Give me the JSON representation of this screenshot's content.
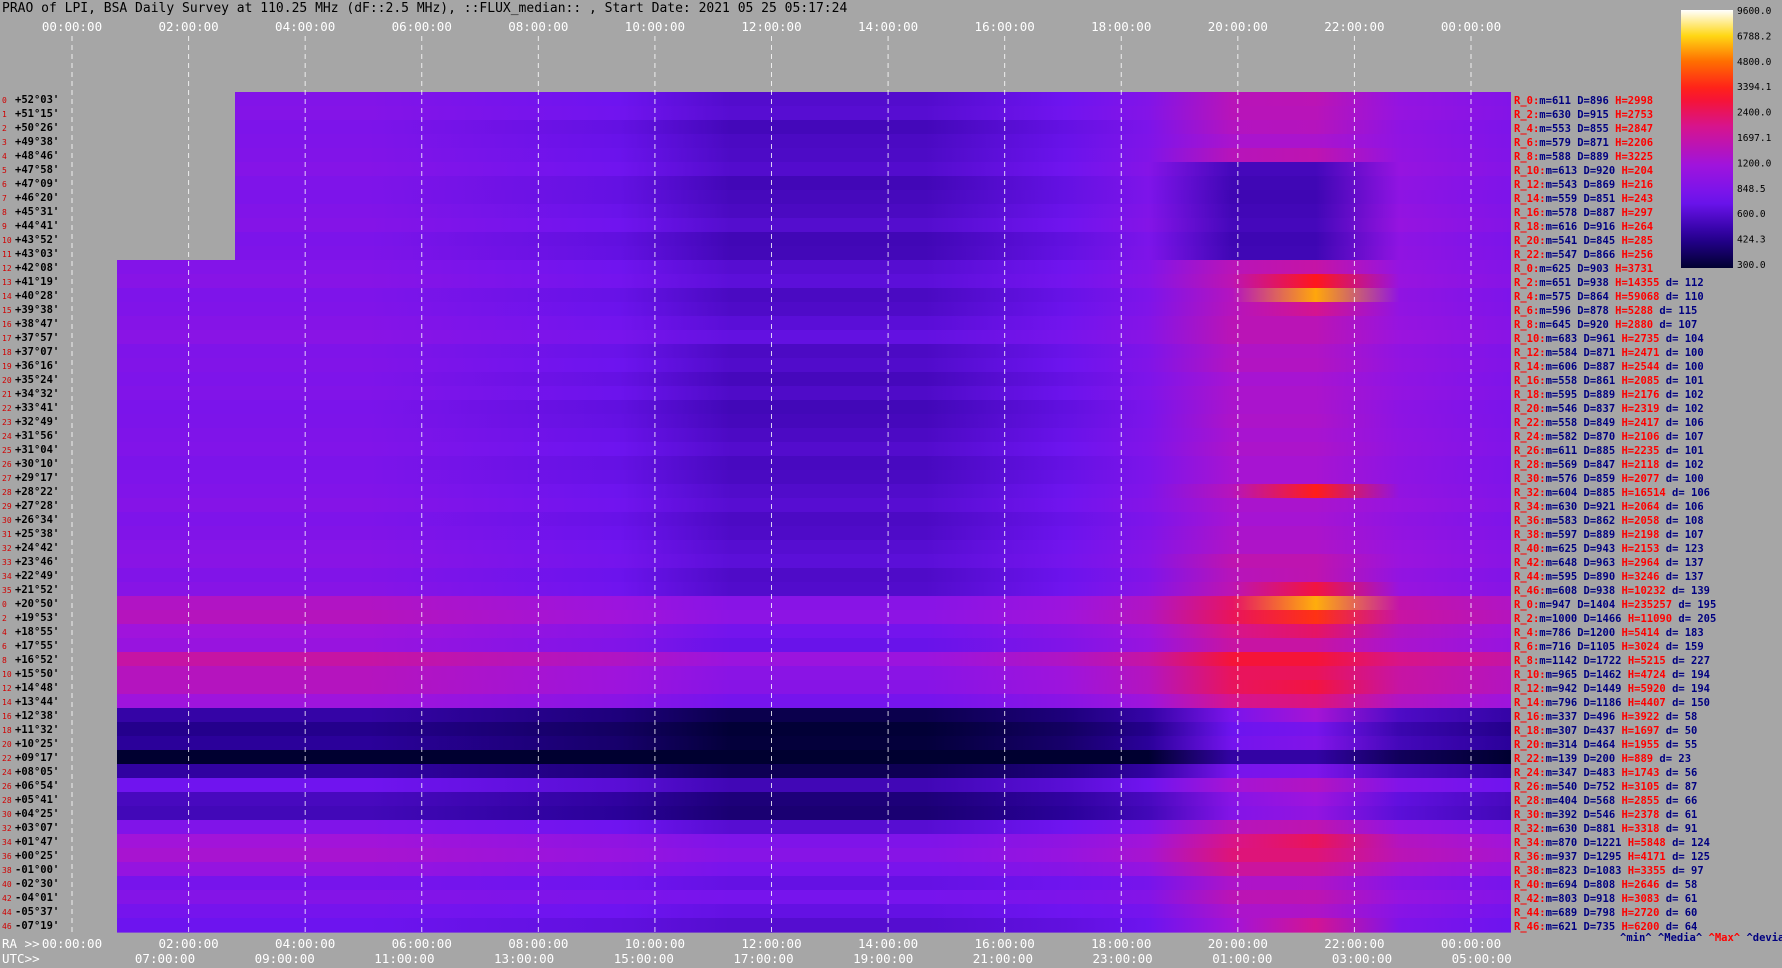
{
  "title": "PRAO of LPI, BSA Daily Survey at 110.25 MHz (dF::2.5 MHz), ::FLUX_median:: , Start Date: 2021 05 25 05:17:24",
  "colors": {
    "background": "#a6a6a6",
    "grid": "#ffffff",
    "min": "#000080",
    "median": "#000080",
    "max": "#ff0000",
    "devia": "#000080",
    "rowlabel": "#d00000"
  },
  "top_axis": [
    "00:00:00",
    "02:00:00",
    "04:00:00",
    "06:00:00",
    "08:00:00",
    "10:00:00",
    "12:00:00",
    "14:00:00",
    "16:00:00",
    "18:00:00",
    "20:00:00",
    "22:00:00",
    "00:00:00"
  ],
  "bottom_axis": {
    "ra_label": "RA >>",
    "ra_ticks": [
      "00:00:00",
      "02:00:00",
      "04:00:00",
      "06:00:00",
      "08:00:00",
      "10:00:00",
      "12:00:00",
      "14:00:00",
      "16:00:00",
      "18:00:00",
      "20:00:00",
      "22:00:00",
      "00:00:00"
    ],
    "utc_label": "UTC>>",
    "utc_ticks": [
      "07:00:00",
      "09:00:00",
      "11:00:00",
      "13:00:00",
      "15:00:00",
      "17:00:00",
      "19:00:00",
      "21:00:00",
      "23:00:00",
      "01:00:00",
      "03:00:00",
      "05:00:00"
    ]
  },
  "colorbar": {
    "ticks": [
      "9600.0",
      "6788.2",
      "4800.0",
      "3394.1",
      "2400.0",
      "1697.1",
      "1200.0",
      "848.5",
      "600.0",
      "424.3",
      "300.0"
    ]
  },
  "stats_legend": {
    "min": "^min^",
    "median": "^Media^",
    "max": "^Max^",
    "devia": "^devia^"
  },
  "chart_data": {
    "type": "heatmap",
    "title": "PRAO of LPI, BSA Daily Survey at 110.25 MHz (dF::2.5 MHz), ::FLUX_median:: , Start Date: 2021 05 25 05:17:24",
    "x_axis_top": "RA 00:00:00 to 00:00:00",
    "color_scale": "log",
    "color_range": [
      300.0,
      9600.0
    ],
    "rows": [
      {
        "num": "0",
        "dec": "+52°03'",
        "label": "R_0:",
        "min": 611,
        "median": 896,
        "max": 2998,
        "devia": null
      },
      {
        "num": "1",
        "dec": "+51°15'",
        "label": "R_2:",
        "min": 630,
        "median": 915,
        "max": 2753,
        "devia": null
      },
      {
        "num": "2",
        "dec": "+50°26'",
        "label": "R_4:",
        "min": 553,
        "median": 855,
        "max": 2847,
        "devia": null
      },
      {
        "num": "3",
        "dec": "+49°38'",
        "label": "R_6:",
        "min": 579,
        "median": 871,
        "max": 2206,
        "devia": null
      },
      {
        "num": "4",
        "dec": "+48°46'",
        "label": "R_8:",
        "min": 588,
        "median": 889,
        "max": 3225,
        "devia": null
      },
      {
        "num": "5",
        "dec": "+47°58'",
        "label": "R_10:",
        "min": 613,
        "median": 920,
        "max": 204,
        "devia": null
      },
      {
        "num": "6",
        "dec": "+47°09'",
        "label": "R_12:",
        "min": 543,
        "median": 869,
        "max": 216,
        "devia": null
      },
      {
        "num": "7",
        "dec": "+46°20'",
        "label": "R_14:",
        "min": 559,
        "median": 851,
        "max": 243,
        "devia": null
      },
      {
        "num": "8",
        "dec": "+45°31'",
        "label": "R_16:",
        "min": 578,
        "median": 887,
        "max": 297,
        "devia": null
      },
      {
        "num": "9",
        "dec": "+44°41'",
        "label": "R_18:",
        "min": 616,
        "median": 916,
        "max": 264,
        "devia": null
      },
      {
        "num": "10",
        "dec": "+43°52'",
        "label": "R_20:",
        "min": 541,
        "median": 845,
        "max": 285,
        "devia": null
      },
      {
        "num": "11",
        "dec": "+43°03'",
        "label": "R_22:",
        "min": 547,
        "median": 866,
        "max": 256,
        "devia": null
      },
      {
        "num": "12",
        "dec": "+42°08'",
        "label": "R_0:",
        "min": 625,
        "median": 903,
        "max": 3731,
        "devia": null
      },
      {
        "num": "13",
        "dec": "+41°19'",
        "label": "R_2:",
        "min": 651,
        "median": 938,
        "max": 14355,
        "devia": 112
      },
      {
        "num": "14",
        "dec": "+40°28'",
        "label": "R_4:",
        "min": 575,
        "median": 864,
        "max": 59068,
        "devia": 110
      },
      {
        "num": "15",
        "dec": "+39°38'",
        "label": "R_6:",
        "min": 596,
        "median": 878,
        "max": 5288,
        "devia": 115
      },
      {
        "num": "16",
        "dec": "+38°47'",
        "label": "R_8:",
        "min": 645,
        "median": 920,
        "max": 2880,
        "devia": 107
      },
      {
        "num": "17",
        "dec": "+37°57'",
        "label": "R_10:",
        "min": 683,
        "median": 961,
        "max": 2735,
        "devia": 104
      },
      {
        "num": "18",
        "dec": "+37°07'",
        "label": "R_12:",
        "min": 584,
        "median": 871,
        "max": 2471,
        "devia": 100
      },
      {
        "num": "19",
        "dec": "+36°16'",
        "label": "R_14:",
        "min": 606,
        "median": 887,
        "max": 2544,
        "devia": 100
      },
      {
        "num": "20",
        "dec": "+35°24'",
        "label": "R_16:",
        "min": 558,
        "median": 861,
        "max": 2085,
        "devia": 101
      },
      {
        "num": "21",
        "dec": "+34°32'",
        "label": "R_18:",
        "min": 595,
        "median": 889,
        "max": 2176,
        "devia": 102
      },
      {
        "num": "22",
        "dec": "+33°41'",
        "label": "R_20:",
        "min": 546,
        "median": 837,
        "max": 2319,
        "devia": 102
      },
      {
        "num": "23",
        "dec": "+32°49'",
        "label": "R_22:",
        "min": 558,
        "median": 849,
        "max": 2417,
        "devia": 106
      },
      {
        "num": "24",
        "dec": "+31°56'",
        "label": "R_24:",
        "min": 582,
        "median": 870,
        "max": 2106,
        "devia": 107
      },
      {
        "num": "25",
        "dec": "+31°04'",
        "label": "R_26:",
        "min": 611,
        "median": 885,
        "max": 2235,
        "devia": 101
      },
      {
        "num": "26",
        "dec": "+30°10'",
        "label": "R_28:",
        "min": 569,
        "median": 847,
        "max": 2118,
        "devia": 102
      },
      {
        "num": "27",
        "dec": "+29°17'",
        "label": "R_30:",
        "min": 576,
        "median": 859,
        "max": 2077,
        "devia": 100
      },
      {
        "num": "28",
        "dec": "+28°22'",
        "label": "R_32:",
        "min": 604,
        "median": 885,
        "max": 16514,
        "devia": 106
      },
      {
        "num": "29",
        "dec": "+27°28'",
        "label": "R_34:",
        "min": 630,
        "median": 921,
        "max": 2064,
        "devia": 106
      },
      {
        "num": "30",
        "dec": "+26°34'",
        "label": "R_36:",
        "min": 583,
        "median": 862,
        "max": 2058,
        "devia": 108
      },
      {
        "num": "31",
        "dec": "+25°38'",
        "label": "R_38:",
        "min": 597,
        "median": 889,
        "max": 2198,
        "devia": 107
      },
      {
        "num": "32",
        "dec": "+24°42'",
        "label": "R_40:",
        "min": 625,
        "median": 943,
        "max": 2153,
        "devia": 123
      },
      {
        "num": "33",
        "dec": "+23°46'",
        "label": "R_42:",
        "min": 648,
        "median": 963,
        "max": 2964,
        "devia": 137
      },
      {
        "num": "34",
        "dec": "+22°49'",
        "label": "R_44:",
        "min": 595,
        "median": 890,
        "max": 3246,
        "devia": 137
      },
      {
        "num": "35",
        "dec": "+21°52'",
        "label": "R_46:",
        "min": 608,
        "median": 938,
        "max": 10232,
        "devia": 139
      },
      {
        "num": "0",
        "dec": "+20°50'",
        "label": "R_0:",
        "min": 947,
        "median": 1404,
        "max": 235257,
        "devia": 195
      },
      {
        "num": "2",
        "dec": "+19°53'",
        "label": "R_2:",
        "min": 1000,
        "median": 1466,
        "max": 11090,
        "devia": 205
      },
      {
        "num": "4",
        "dec": "+18°55'",
        "label": "R_4:",
        "min": 786,
        "median": 1200,
        "max": 5414,
        "devia": 183
      },
      {
        "num": "6",
        "dec": "+17°55'",
        "label": "R_6:",
        "min": 716,
        "median": 1105,
        "max": 3024,
        "devia": 159
      },
      {
        "num": "8",
        "dec": "+16°52'",
        "label": "R_8:",
        "min": 1142,
        "median": 1722,
        "max": 5215,
        "devia": 227
      },
      {
        "num": "10",
        "dec": "+15°50'",
        "label": "R_10:",
        "min": 965,
        "median": 1462,
        "max": 4724,
        "devia": 194
      },
      {
        "num": "12",
        "dec": "+14°48'",
        "label": "R_12:",
        "min": 942,
        "median": 1449,
        "max": 5920,
        "devia": 194
      },
      {
        "num": "14",
        "dec": "+13°44'",
        "label": "R_14:",
        "min": 796,
        "median": 1186,
        "max": 4407,
        "devia": 150
      },
      {
        "num": "16",
        "dec": "+12°38'",
        "label": "R_16:",
        "min": 337,
        "median": 496,
        "max": 3922,
        "devia": 58
      },
      {
        "num": "18",
        "dec": "+11°32'",
        "label": "R_18:",
        "min": 307,
        "median": 437,
        "max": 1697,
        "devia": 50
      },
      {
        "num": "20",
        "dec": "+10°25'",
        "label": "R_20:",
        "min": 314,
        "median": 464,
        "max": 1955,
        "devia": 55
      },
      {
        "num": "22",
        "dec": "+09°17'",
        "label": "R_22:",
        "min": 139,
        "median": 200,
        "max": 889,
        "devia": 23
      },
      {
        "num": "24",
        "dec": "+08°05'",
        "label": "R_24:",
        "min": 347,
        "median": 483,
        "max": 1743,
        "devia": 56
      },
      {
        "num": "26",
        "dec": "+06°54'",
        "label": "R_26:",
        "min": 540,
        "median": 752,
        "max": 3105,
        "devia": 87
      },
      {
        "num": "28",
        "dec": "+05°41'",
        "label": "R_28:",
        "min": 404,
        "median": 568,
        "max": 2855,
        "devia": 66
      },
      {
        "num": "30",
        "dec": "+04°25'",
        "label": "R_30:",
        "min": 392,
        "median": 546,
        "max": 2378,
        "devia": 61
      },
      {
        "num": "32",
        "dec": "+03°07'",
        "label": "R_32:",
        "min": 630,
        "median": 881,
        "max": 3318,
        "devia": 91
      },
      {
        "num": "34",
        "dec": "+01°47'",
        "label": "R_34:",
        "min": 870,
        "median": 1221,
        "max": 5848,
        "devia": 124
      },
      {
        "num": "36",
        "dec": "+00°25'",
        "label": "R_36:",
        "min": 937,
        "median": 1295,
        "max": 4171,
        "devia": 125
      },
      {
        "num": "38",
        "dec": "-01°00'",
        "label": "R_38:",
        "min": 823,
        "median": 1083,
        "max": 3355,
        "devia": 97
      },
      {
        "num": "40",
        "dec": "-02°30'",
        "label": "R_40:",
        "min": 694,
        "median": 808,
        "max": 2646,
        "devia": 58
      },
      {
        "num": "42",
        "dec": "-04°01'",
        "label": "R_42:",
        "min": 803,
        "median": 918,
        "max": 3083,
        "devia": 61
      },
      {
        "num": "44",
        "dec": "-05°37'",
        "label": "R_44:",
        "min": 689,
        "median": 798,
        "max": 2720,
        "devia": 60
      },
      {
        "num": "46",
        "dec": "-07°19'",
        "label": "R_46:",
        "min": 621,
        "median": 735,
        "max": 6200,
        "devia": 64
      }
    ]
  }
}
